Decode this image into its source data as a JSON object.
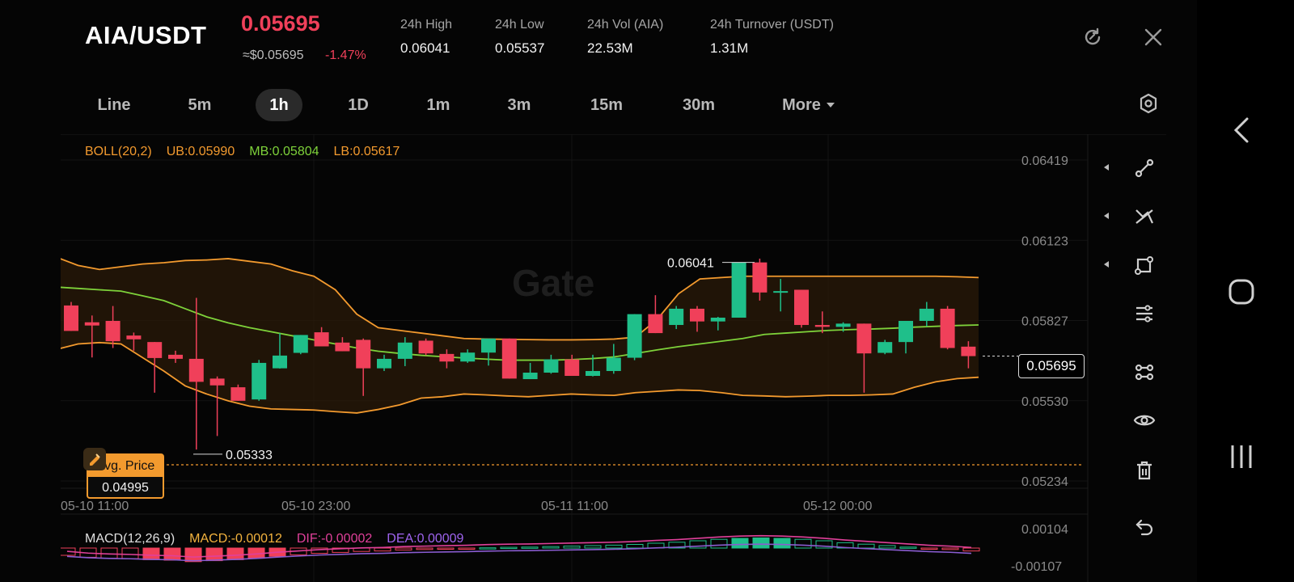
{
  "header": {
    "pair": "AIA/USDT",
    "last_price": "0.05695",
    "fiat_price": "≈$0.05695",
    "change": "-1.47%",
    "stats": [
      {
        "label": "24h   High",
        "value": "0.06041"
      },
      {
        "label": "24h   Low",
        "value": "0.05537"
      },
      {
        "label": "24h   Vol (AIA)",
        "value": "22.53M"
      },
      {
        "label": "24h   Turnover (USDT)",
        "value": "1.31M"
      }
    ],
    "icons": [
      "refresh-icon",
      "close-icon"
    ]
  },
  "timeframes": [
    {
      "label": "Line",
      "active": false
    },
    {
      "label": "5m",
      "active": false
    },
    {
      "label": "1h",
      "active": true
    },
    {
      "label": "1D",
      "active": false
    },
    {
      "label": "1m",
      "active": false
    },
    {
      "label": "3m",
      "active": false
    },
    {
      "label": "15m",
      "active": false
    },
    {
      "label": "30m",
      "active": false
    },
    {
      "label": "More",
      "active": false
    }
  ],
  "indicators": {
    "boll": {
      "name": "BOLL(20,2)",
      "ub": "UB:0.05990",
      "mb": "MB:0.05804",
      "lb": "LB:0.05617"
    },
    "macd": {
      "name": "MACD(12,26,9)",
      "macd": "MACD:-0.00012",
      "dif": "DIF:-0.00002",
      "dea": "DEA:0.00009"
    }
  },
  "watermark": "Gate",
  "avg_price": {
    "label": "Avg. Price",
    "value": "0.04995"
  },
  "current_price_tag": "0.05695",
  "high_marker": "0.06041",
  "low_marker": "0.05333",
  "colors": {
    "up": "#1fbf8a",
    "down": "#f0405a",
    "ub_lb": "#f39a2e",
    "mb": "#7ed23a",
    "dif": "#e0409a",
    "dea": "#8a5cd0"
  },
  "toolbar": [
    "line-draw-icon",
    "trend-tool-icon",
    "shape-tool-icon",
    "settings-sliders-icon",
    "indicator-icon",
    "eye-icon",
    "trash-icon",
    "undo-icon"
  ],
  "system_nav": [
    "back-icon",
    "home-icon",
    "recents-icon"
  ],
  "chart_data": {
    "type": "candlestick",
    "y_ticks": [
      "0.06419",
      "0.06123",
      "0.05827",
      "0.05530",
      "0.05234"
    ],
    "ylim": [
      0.05234,
      0.06419
    ],
    "x_ticks": [
      "05-10 11:00",
      "05-10 23:00",
      "05-11 11:00",
      "05-12 00:00"
    ],
    "macd_ticks": [
      "0.00104",
      "-0.00107"
    ],
    "candles": [
      {
        "o": 0.05882,
        "h": 0.05895,
        "l": 0.05818,
        "c": 0.05788
      },
      {
        "o": 0.0582,
        "h": 0.05845,
        "l": 0.0569,
        "c": 0.05808
      },
      {
        "o": 0.05825,
        "h": 0.0588,
        "l": 0.05725,
        "c": 0.0575
      },
      {
        "o": 0.05771,
        "h": 0.05782,
        "l": 0.05715,
        "c": 0.05757
      },
      {
        "o": 0.05747,
        "h": 0.05745,
        "l": 0.0556,
        "c": 0.05688
      },
      {
        "o": 0.057,
        "h": 0.05715,
        "l": 0.0567,
        "c": 0.05685
      },
      {
        "o": 0.05685,
        "h": 0.0591,
        "l": 0.0535,
        "c": 0.056
      },
      {
        "o": 0.05612,
        "h": 0.0562,
        "l": 0.054,
        "c": 0.05587
      },
      {
        "o": 0.0558,
        "h": 0.0559,
        "l": 0.0553,
        "c": 0.0553
      },
      {
        "o": 0.05535,
        "h": 0.05681,
        "l": 0.0553,
        "c": 0.0567
      },
      {
        "o": 0.0565,
        "h": 0.0578,
        "l": 0.05649,
        "c": 0.05697
      },
      {
        "o": 0.05707,
        "h": 0.05773,
        "l": 0.05702,
        "c": 0.05773
      },
      {
        "o": 0.05783,
        "h": 0.05802,
        "l": 0.05738,
        "c": 0.05731
      },
      {
        "o": 0.05745,
        "h": 0.05765,
        "l": 0.05725,
        "c": 0.05713
      },
      {
        "o": 0.05755,
        "h": 0.0576,
        "l": 0.05548,
        "c": 0.0565
      },
      {
        "o": 0.0565,
        "h": 0.057,
        "l": 0.0564,
        "c": 0.05685
      },
      {
        "o": 0.05685,
        "h": 0.05765,
        "l": 0.05658,
        "c": 0.05745
      },
      {
        "o": 0.05752,
        "h": 0.0576,
        "l": 0.05698,
        "c": 0.05705
      },
      {
        "o": 0.05703,
        "h": 0.0572,
        "l": 0.0565,
        "c": 0.05675
      },
      {
        "o": 0.05675,
        "h": 0.0572,
        "l": 0.0567,
        "c": 0.05708
      },
      {
        "o": 0.05708,
        "h": 0.0575,
        "l": 0.0566,
        "c": 0.0576
      },
      {
        "o": 0.0576,
        "h": 0.0576,
        "l": 0.0567,
        "c": 0.05612
      },
      {
        "o": 0.0561,
        "h": 0.0567,
        "l": 0.05618,
        "c": 0.05634
      },
      {
        "o": 0.05634,
        "h": 0.057,
        "l": 0.0563,
        "c": 0.05683
      },
      {
        "o": 0.05683,
        "h": 0.057,
        "l": 0.0564,
        "c": 0.05622
      },
      {
        "o": 0.05622,
        "h": 0.057,
        "l": 0.0562,
        "c": 0.0564
      },
      {
        "o": 0.0564,
        "h": 0.0574,
        "l": 0.0563,
        "c": 0.05689
      },
      {
        "o": 0.05689,
        "h": 0.058,
        "l": 0.0568,
        "c": 0.0585
      },
      {
        "o": 0.0585,
        "h": 0.0592,
        "l": 0.05795,
        "c": 0.0578
      },
      {
        "o": 0.0581,
        "h": 0.0588,
        "l": 0.05795,
        "c": 0.0587
      },
      {
        "o": 0.0587,
        "h": 0.0588,
        "l": 0.05785,
        "c": 0.05823
      },
      {
        "o": 0.05823,
        "h": 0.0584,
        "l": 0.0579,
        "c": 0.05837
      },
      {
        "o": 0.05837,
        "h": 0.06041,
        "l": 0.05837,
        "c": 0.06041
      },
      {
        "o": 0.06041,
        "h": 0.06055,
        "l": 0.059,
        "c": 0.0593
      },
      {
        "o": 0.0593,
        "h": 0.0598,
        "l": 0.0586,
        "c": 0.05935
      },
      {
        "o": 0.0594,
        "h": 0.0594,
        "l": 0.058,
        "c": 0.0581
      },
      {
        "o": 0.0581,
        "h": 0.0586,
        "l": 0.0578,
        "c": 0.05803
      },
      {
        "o": 0.05803,
        "h": 0.0582,
        "l": 0.05785,
        "c": 0.05815
      },
      {
        "o": 0.05815,
        "h": 0.05815,
        "l": 0.0556,
        "c": 0.05705
      },
      {
        "o": 0.05707,
        "h": 0.05755,
        "l": 0.05702,
        "c": 0.05747
      },
      {
        "o": 0.05747,
        "h": 0.05825,
        "l": 0.05705,
        "c": 0.05825
      },
      {
        "o": 0.05825,
        "h": 0.05895,
        "l": 0.05805,
        "c": 0.0587
      },
      {
        "o": 0.0587,
        "h": 0.0588,
        "l": 0.0572,
        "c": 0.05725
      },
      {
        "o": 0.0573,
        "h": 0.0575,
        "l": 0.0565,
        "c": 0.05695
      }
    ],
    "ub": [
      0.0606,
      0.0603,
      0.06015,
      0.06025,
      0.06035,
      0.0604,
      0.06048,
      0.0605,
      0.06055,
      0.06045,
      0.06035,
      0.0601,
      0.0599,
      0.0594,
      0.0585,
      0.058,
      0.0579,
      0.0578,
      0.0577,
      0.0576,
      0.05758,
      0.05757,
      0.05756,
      0.05755,
      0.05755,
      0.05756,
      0.05758,
      0.05765,
      0.0583,
      0.05925,
      0.0598,
      0.05985,
      0.0599,
      0.0599,
      0.0599,
      0.0599,
      0.0599,
      0.0599,
      0.0599,
      0.0599,
      0.0599,
      0.0599,
      0.05988,
      0.05985
    ],
    "mb": [
      0.0595,
      0.05945,
      0.0594,
      0.05935,
      0.05918,
      0.059,
      0.0587,
      0.0584,
      0.05818,
      0.058,
      0.05785,
      0.0577,
      0.05755,
      0.0574,
      0.05725,
      0.05713,
      0.05705,
      0.05698,
      0.05693,
      0.05688,
      0.05684,
      0.0568,
      0.0568,
      0.0568,
      0.05682,
      0.05686,
      0.05692,
      0.05705,
      0.05718,
      0.0573,
      0.0574,
      0.0575,
      0.0576,
      0.05775,
      0.0578,
      0.05785,
      0.0579,
      0.05793,
      0.05795,
      0.05798,
      0.05802,
      0.05805,
      0.05808,
      0.0581
    ],
    "lb": [
      0.0572,
      0.0574,
      0.05745,
      0.0574,
      0.0569,
      0.0564,
      0.05585,
      0.05555,
      0.0553,
      0.0551,
      0.055,
      0.05498,
      0.05496,
      0.0549,
      0.05485,
      0.05498,
      0.05515,
      0.0554,
      0.05545,
      0.05555,
      0.05552,
      0.05548,
      0.05545,
      0.0555,
      0.05555,
      0.05552,
      0.0555,
      0.0556,
      0.05565,
      0.0557,
      0.05568,
      0.0556,
      0.0555,
      0.05548,
      0.05545,
      0.05547,
      0.0555,
      0.0555,
      0.05552,
      0.05555,
      0.0558,
      0.056,
      0.05612,
      0.05617
    ],
    "macd_hist": [
      -0.0003,
      -0.00038,
      -0.00042,
      -0.00044,
      -0.00048,
      -0.0005,
      -0.00056,
      -0.00052,
      -0.00048,
      -0.00042,
      -0.00034,
      -0.00028,
      -0.00022,
      -0.00018,
      -0.00014,
      -0.00012,
      -8e-05,
      -6e-05,
      -4e-05,
      -2e-05,
      1e-05,
      3e-05,
      4e-05,
      6e-05,
      8e-05,
      0.0001,
      0.00012,
      0.00015,
      0.0002,
      0.00024,
      0.0003,
      0.00036,
      0.0004,
      0.00042,
      0.0004,
      0.00036,
      0.0003,
      0.00022,
      0.00016,
      0.0001,
      4e-05,
      -2e-05,
      -6e-05,
      -0.00012
    ]
  }
}
